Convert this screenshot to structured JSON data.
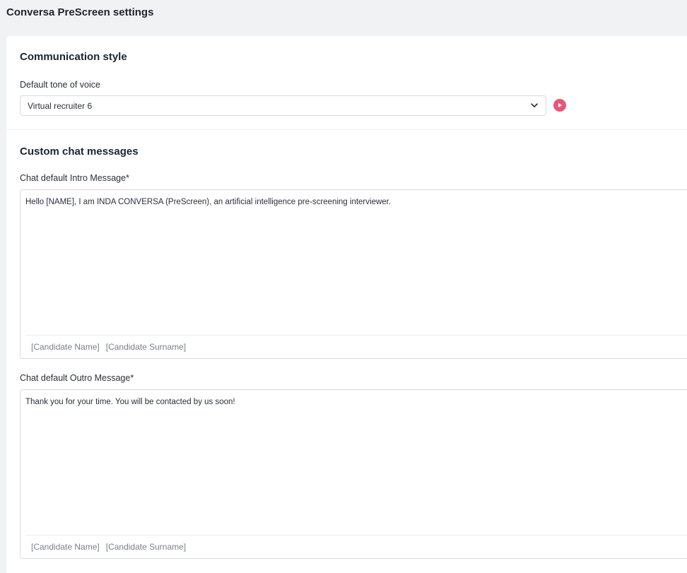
{
  "page": {
    "title": "Conversa PreScreen settings"
  },
  "communication_style": {
    "heading": "Communication style",
    "tone_label": "Default tone of voice",
    "tone_value": "Virtual recruiter 6"
  },
  "custom_messages": {
    "heading": "Custom chat messages",
    "intro": {
      "label": "Chat default Intro Message*",
      "value": "Hello [NAME], I am INDA CONVERSA (PreScreen), an artificial intelligence pre-screening interviewer.",
      "tags": [
        "[Candidate Name]",
        "[Candidate Surname]"
      ]
    },
    "outro": {
      "label": "Chat default Outro Message*",
      "value": "Thank you for your time. You will be contacted by us soon!",
      "tags": [
        "[Candidate Name]",
        "[Candidate Surname]"
      ]
    }
  },
  "colors": {
    "accent": "#e8557a",
    "background": "#f1f2f4",
    "card": "#ffffff",
    "border": "#d9dbe0"
  },
  "icons": {
    "select_chevron": "chevron-down-icon",
    "preview": "play-icon"
  }
}
